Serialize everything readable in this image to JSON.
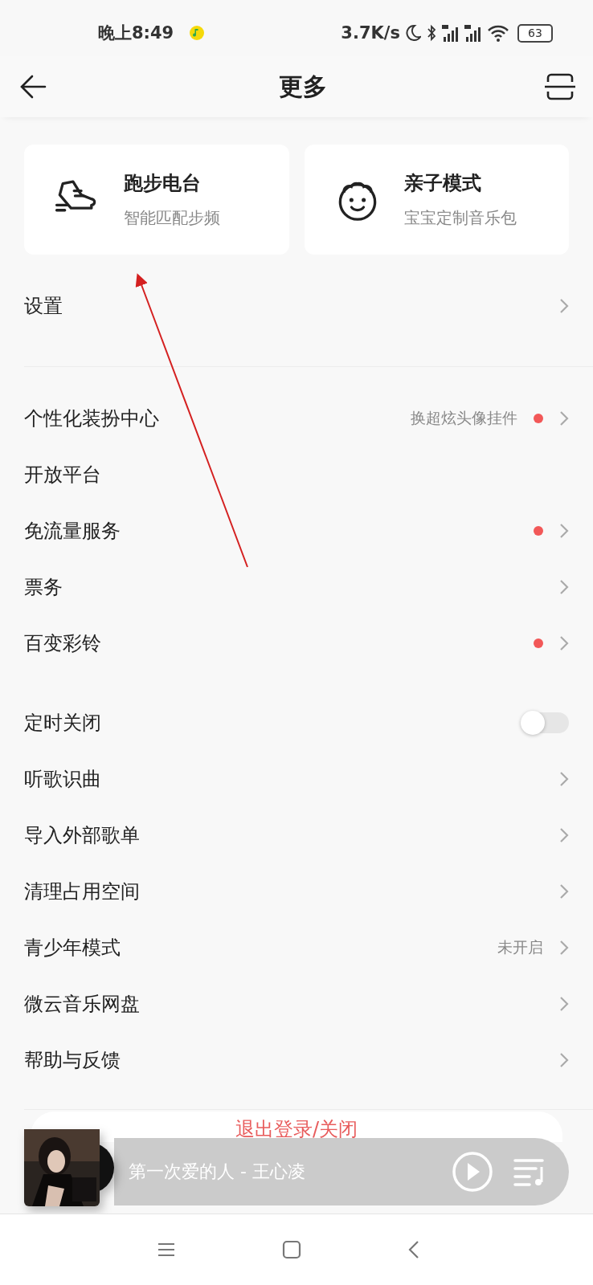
{
  "status_bar": {
    "time": "晚上8:49",
    "speed": "3.7K/s",
    "battery": "63"
  },
  "header": {
    "title": "更多"
  },
  "cards": [
    {
      "kind": "shoe",
      "title": "跑步电台",
      "subtitle": "智能匹配步频"
    },
    {
      "kind": "kid",
      "title": "亲子模式",
      "subtitle": "宝宝定制音乐包"
    }
  ],
  "sections": [
    {
      "items": [
        {
          "kind": "link",
          "label": "设置",
          "dot": false
        }
      ]
    },
    {
      "items": [
        {
          "kind": "link",
          "label": "个性化装扮中心",
          "hint": "换超炫头像挂件",
          "dot": true
        },
        {
          "kind": "plain",
          "label": "开放平台"
        },
        {
          "kind": "link",
          "label": "免流量服务",
          "dot": true
        },
        {
          "kind": "link",
          "label": "票务",
          "dot": false
        },
        {
          "kind": "link",
          "label": "百变彩铃",
          "dot": true
        }
      ]
    },
    {
      "items": [
        {
          "kind": "toggle",
          "label": "定时关闭",
          "on": false
        },
        {
          "kind": "link",
          "label": "听歌识曲",
          "dot": false
        },
        {
          "kind": "link",
          "label": "导入外部歌单",
          "dot": false
        },
        {
          "kind": "link",
          "label": "清理占用空间",
          "dot": false
        },
        {
          "kind": "link",
          "label": "青少年模式",
          "hint": "未开启",
          "dot": false
        },
        {
          "kind": "link",
          "label": "微云音乐网盘",
          "dot": false
        },
        {
          "kind": "link",
          "label": "帮助与反馈",
          "dot": false
        }
      ]
    }
  ],
  "logout_button": "退出登录/关闭",
  "player": {
    "song": "第一次爱的人 - 王心凌"
  }
}
